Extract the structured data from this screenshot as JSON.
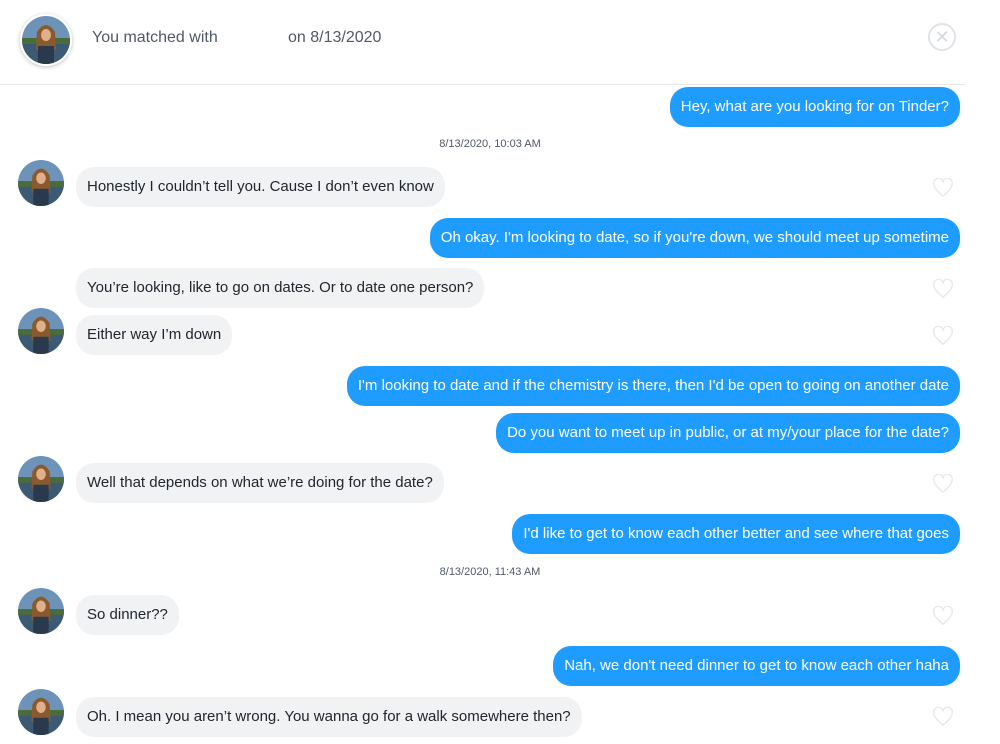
{
  "header": {
    "matched_text": "You matched with",
    "match_date": "on 8/13/2020",
    "close_icon": "close-circle-icon"
  },
  "colors": {
    "sent_bubble": "#1e9cff",
    "received_bubble": "#f0f2f4"
  },
  "messages": [
    {
      "type": "sent",
      "text": "Hey, what are you looking for on Tinder?"
    },
    {
      "type": "timestamp",
      "text": "8/13/2020, 10:03 AM"
    },
    {
      "type": "received",
      "text": "Honestly I couldn’t tell you. Cause I don’t even know"
    },
    {
      "type": "sent",
      "text": "Oh okay. I'm looking to date, so if you're down, we should meet up sometime"
    },
    {
      "type": "received",
      "text": "You’re looking, like to go on dates. Or to date one person?"
    },
    {
      "type": "received",
      "text": "Either way I’m down"
    },
    {
      "type": "sent",
      "text": "I'm looking to date and if the chemistry is there, then I'd be open to going on another date"
    },
    {
      "type": "sent",
      "text": "Do you want to meet up in public, or at my/your place for the date?"
    },
    {
      "type": "received",
      "text": "Well that depends on what we’re doing for the date?"
    },
    {
      "type": "sent",
      "text": "I'd like to get to know each other better and see where that goes"
    },
    {
      "type": "timestamp",
      "text": "8/13/2020, 11:43 AM"
    },
    {
      "type": "received",
      "text": "So dinner??"
    },
    {
      "type": "sent",
      "text": "Nah, we don't need dinner to get to know each other haha"
    },
    {
      "type": "received",
      "text": "Oh. I mean you aren’t wrong. You wanna go for a walk somewhere then?"
    }
  ]
}
